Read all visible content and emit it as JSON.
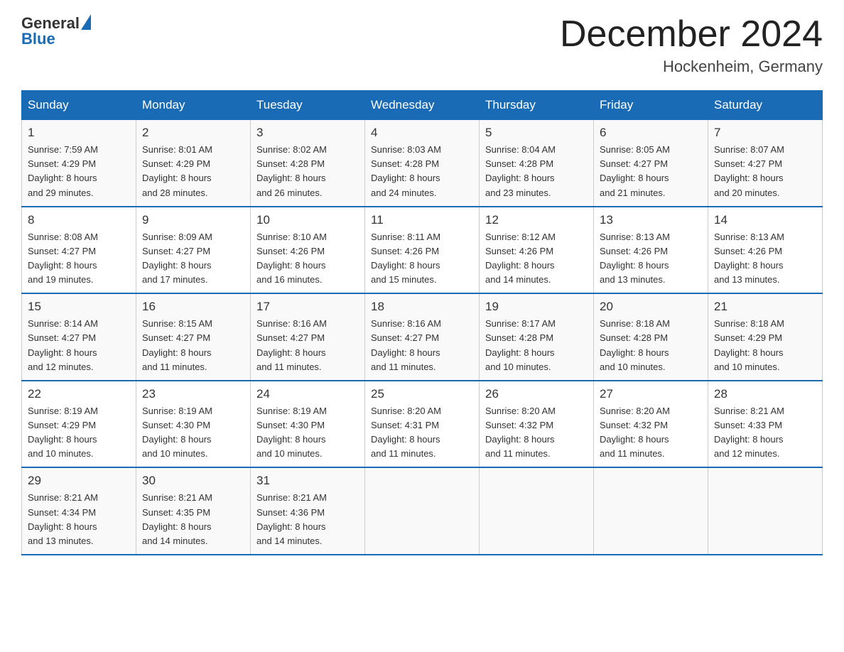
{
  "header": {
    "logo_general": "General",
    "logo_blue": "Blue",
    "title": "December 2024",
    "subtitle": "Hockenheim, Germany"
  },
  "columns": [
    "Sunday",
    "Monday",
    "Tuesday",
    "Wednesday",
    "Thursday",
    "Friday",
    "Saturday"
  ],
  "weeks": [
    [
      {
        "day": "1",
        "sunrise": "7:59 AM",
        "sunset": "4:29 PM",
        "daylight": "8 hours and 29 minutes."
      },
      {
        "day": "2",
        "sunrise": "8:01 AM",
        "sunset": "4:29 PM",
        "daylight": "8 hours and 28 minutes."
      },
      {
        "day": "3",
        "sunrise": "8:02 AM",
        "sunset": "4:28 PM",
        "daylight": "8 hours and 26 minutes."
      },
      {
        "day": "4",
        "sunrise": "8:03 AM",
        "sunset": "4:28 PM",
        "daylight": "8 hours and 24 minutes."
      },
      {
        "day": "5",
        "sunrise": "8:04 AM",
        "sunset": "4:28 PM",
        "daylight": "8 hours and 23 minutes."
      },
      {
        "day": "6",
        "sunrise": "8:05 AM",
        "sunset": "4:27 PM",
        "daylight": "8 hours and 21 minutes."
      },
      {
        "day": "7",
        "sunrise": "8:07 AM",
        "sunset": "4:27 PM",
        "daylight": "8 hours and 20 minutes."
      }
    ],
    [
      {
        "day": "8",
        "sunrise": "8:08 AM",
        "sunset": "4:27 PM",
        "daylight": "8 hours and 19 minutes."
      },
      {
        "day": "9",
        "sunrise": "8:09 AM",
        "sunset": "4:27 PM",
        "daylight": "8 hours and 17 minutes."
      },
      {
        "day": "10",
        "sunrise": "8:10 AM",
        "sunset": "4:26 PM",
        "daylight": "8 hours and 16 minutes."
      },
      {
        "day": "11",
        "sunrise": "8:11 AM",
        "sunset": "4:26 PM",
        "daylight": "8 hours and 15 minutes."
      },
      {
        "day": "12",
        "sunrise": "8:12 AM",
        "sunset": "4:26 PM",
        "daylight": "8 hours and 14 minutes."
      },
      {
        "day": "13",
        "sunrise": "8:13 AM",
        "sunset": "4:26 PM",
        "daylight": "8 hours and 13 minutes."
      },
      {
        "day": "14",
        "sunrise": "8:13 AM",
        "sunset": "4:26 PM",
        "daylight": "8 hours and 13 minutes."
      }
    ],
    [
      {
        "day": "15",
        "sunrise": "8:14 AM",
        "sunset": "4:27 PM",
        "daylight": "8 hours and 12 minutes."
      },
      {
        "day": "16",
        "sunrise": "8:15 AM",
        "sunset": "4:27 PM",
        "daylight": "8 hours and 11 minutes."
      },
      {
        "day": "17",
        "sunrise": "8:16 AM",
        "sunset": "4:27 PM",
        "daylight": "8 hours and 11 minutes."
      },
      {
        "day": "18",
        "sunrise": "8:16 AM",
        "sunset": "4:27 PM",
        "daylight": "8 hours and 11 minutes."
      },
      {
        "day": "19",
        "sunrise": "8:17 AM",
        "sunset": "4:28 PM",
        "daylight": "8 hours and 10 minutes."
      },
      {
        "day": "20",
        "sunrise": "8:18 AM",
        "sunset": "4:28 PM",
        "daylight": "8 hours and 10 minutes."
      },
      {
        "day": "21",
        "sunrise": "8:18 AM",
        "sunset": "4:29 PM",
        "daylight": "8 hours and 10 minutes."
      }
    ],
    [
      {
        "day": "22",
        "sunrise": "8:19 AM",
        "sunset": "4:29 PM",
        "daylight": "8 hours and 10 minutes."
      },
      {
        "day": "23",
        "sunrise": "8:19 AM",
        "sunset": "4:30 PM",
        "daylight": "8 hours and 10 minutes."
      },
      {
        "day": "24",
        "sunrise": "8:19 AM",
        "sunset": "4:30 PM",
        "daylight": "8 hours and 10 minutes."
      },
      {
        "day": "25",
        "sunrise": "8:20 AM",
        "sunset": "4:31 PM",
        "daylight": "8 hours and 11 minutes."
      },
      {
        "day": "26",
        "sunrise": "8:20 AM",
        "sunset": "4:32 PM",
        "daylight": "8 hours and 11 minutes."
      },
      {
        "day": "27",
        "sunrise": "8:20 AM",
        "sunset": "4:32 PM",
        "daylight": "8 hours and 11 minutes."
      },
      {
        "day": "28",
        "sunrise": "8:21 AM",
        "sunset": "4:33 PM",
        "daylight": "8 hours and 12 minutes."
      }
    ],
    [
      {
        "day": "29",
        "sunrise": "8:21 AM",
        "sunset": "4:34 PM",
        "daylight": "8 hours and 13 minutes."
      },
      {
        "day": "30",
        "sunrise": "8:21 AM",
        "sunset": "4:35 PM",
        "daylight": "8 hours and 14 minutes."
      },
      {
        "day": "31",
        "sunrise": "8:21 AM",
        "sunset": "4:36 PM",
        "daylight": "8 hours and 14 minutes."
      },
      null,
      null,
      null,
      null
    ]
  ],
  "labels": {
    "sunrise": "Sunrise:",
    "sunset": "Sunset:",
    "daylight": "Daylight:"
  }
}
